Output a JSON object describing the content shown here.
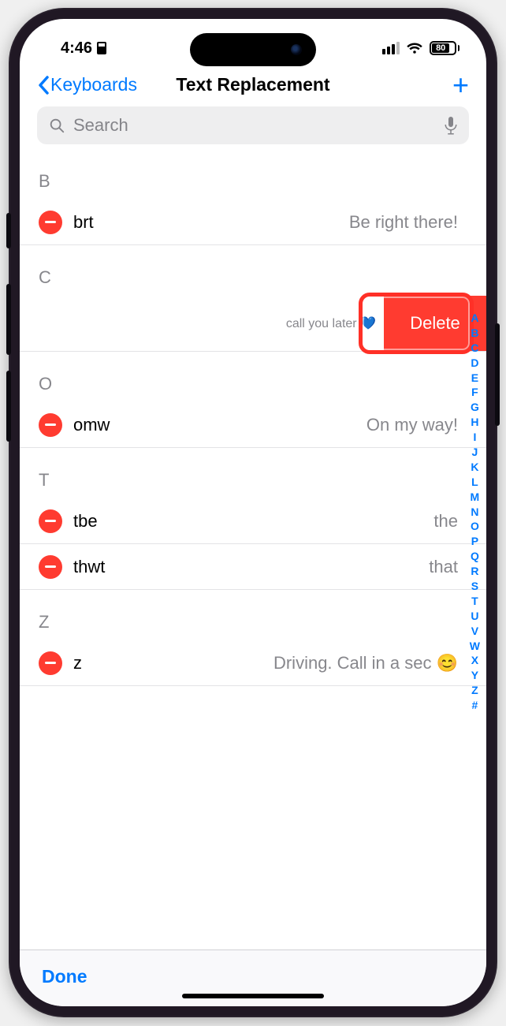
{
  "status": {
    "time": "4:46",
    "battery": "80"
  },
  "nav": {
    "back": "Keyboards",
    "title": "Text Replacement"
  },
  "search": {
    "placeholder": "Search"
  },
  "sections": [
    {
      "letter": "B",
      "items": [
        {
          "shortcut": "brt",
          "phrase": "Be right there!",
          "swiped": false
        }
      ]
    },
    {
      "letter": "C",
      "items": [
        {
          "shortcut": "",
          "phrase": "call you later 💙",
          "swiped": true
        }
      ]
    },
    {
      "letter": "O",
      "items": [
        {
          "shortcut": "omw",
          "phrase": "On my way!",
          "swiped": false
        }
      ]
    },
    {
      "letter": "T",
      "items": [
        {
          "shortcut": "tbe",
          "phrase": "the",
          "swiped": false
        },
        {
          "shortcut": "thwt",
          "phrase": "that",
          "swiped": false
        }
      ]
    },
    {
      "letter": "Z",
      "items": [
        {
          "shortcut": "z",
          "phrase": "Driving. Call in a sec 😊",
          "swiped": false
        }
      ]
    }
  ],
  "delete_label": "Delete",
  "index_letters": [
    "A",
    "B",
    "C",
    "D",
    "E",
    "F",
    "G",
    "H",
    "I",
    "J",
    "K",
    "L",
    "M",
    "N",
    "O",
    "P",
    "Q",
    "R",
    "S",
    "T",
    "U",
    "V",
    "W",
    "X",
    "Y",
    "Z",
    "#"
  ],
  "toolbar": {
    "done": "Done"
  }
}
